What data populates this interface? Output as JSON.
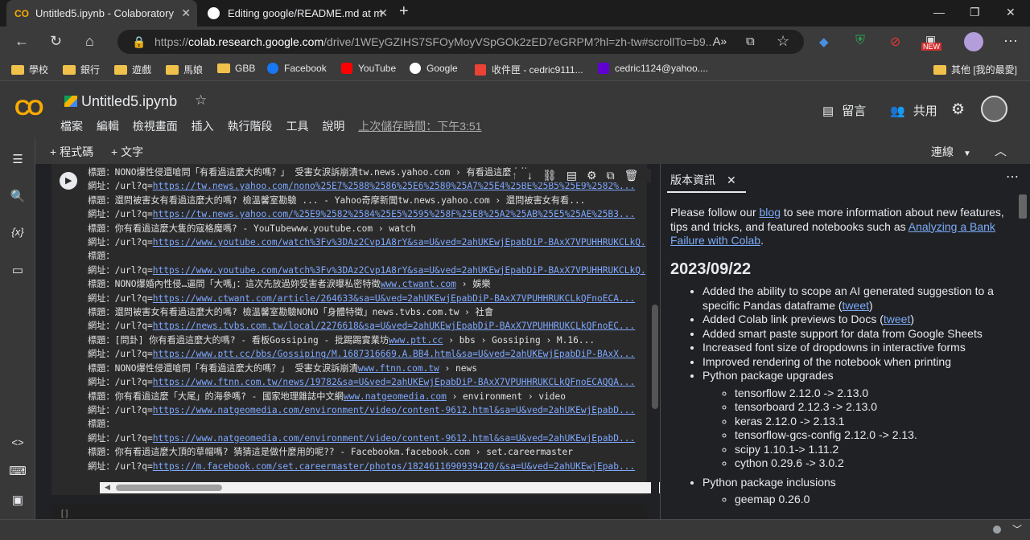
{
  "browser": {
    "tabs": [
      {
        "title": "Untitled5.ipynb - Colaboratory"
      },
      {
        "title": "Editing google/README.md at m"
      }
    ],
    "url_prefix": "https://",
    "url_host": "colab.research.google.com",
    "url_rest": "/drive/1WEyGZIHS7SFOyMoyVSpGOk2zED7eGRPM?hl=zh-tw#scrollTo=b9...",
    "bookmarks": [
      "學校",
      "銀行",
      "遊戲",
      "馬娘",
      "GBB",
      "Facebook",
      "YouTube",
      "Google",
      "收件匣 - cedric9111...",
      "cedric1124@yahoo....",
      "其他 [我的最愛]"
    ],
    "badge_new": "NEW"
  },
  "colab": {
    "logo": "CO",
    "notebook_title": "Untitled5.ipynb",
    "menu": [
      "檔案",
      "編輯",
      "檢視畫面",
      "插入",
      "執行階段",
      "工具",
      "說明"
    ],
    "last_saved": "上次儲存時間：下午3:51",
    "comment_label": "留言",
    "share_label": "共用",
    "add_code": "+ 程式碼",
    "add_text": "+ 文字",
    "connect": "連線",
    "cell_output": [
      {
        "l": "標題：",
        "t": "NONO爆性侵還嗆問「有看過這麼大的嗎？」 受害女淚訴崩潰tw.news.yahoo.com › 有看過這麼大的..."
      },
      {
        "l": "網址：",
        "t": "/url?q=",
        "u": "https://tw.news.yahoo.com/nono%25E7%2588%2586%25E6%2580%25A7%25E4%25BE%25B5%25E9%2582%..."
      },
      {
        "l": "標題：",
        "t": "還問被害女有看過這麼大的嗎? 檢溫馨室勘驗 ... - Yahoo奇摩新聞tw.news.yahoo.com › 還問被害女有看..."
      },
      {
        "l": "網址：",
        "t": "/url?q=",
        "u": "https://tw.news.yahoo.com/%25E9%2582%2584%25E5%2595%258F%25E8%25A2%25AB%25E5%25AE%25B3..."
      },
      {
        "l": "標題：",
        "t": "你有看過這麼大隻的寇格魔嗎? - YouTubewww.youtube.com › watch"
      },
      {
        "l": "網址：",
        "t": "/url?q=",
        "u": "https://www.youtube.com/watch%3Fv%3DAz2Cvp1A8rY&sa=U&ved=2ahUKEwjEpabDiP-BAxX7VPUHHRUKCLkQ..."
      },
      {
        "l": "標題：",
        "t": ""
      },
      {
        "l": "網址：",
        "t": "/url?q=",
        "u": "https://www.youtube.com/watch%3Fv%3DAz2Cvp1A8rY&sa=U&ved=2ahUKEwjEpabDiP-BAxX7VPUHHRUKCLkQ..."
      },
      {
        "l": "標題：",
        "t": "NONO爆婚內性侵…逼問「大嗎」：這次先放過妳受害者淚曝私密特徵",
        "u2": "www.ctwant.com",
        "t2": " › 娛樂"
      },
      {
        "l": "網址：",
        "t": "/url?q=",
        "u": "https://www.ctwant.com/article/264633&sa=U&ved=2ahUKEwjEpabDiP-BAxX7VPUHHRUKCLkQFnoECA..."
      },
      {
        "l": "標題：",
        "t": "還問被害女有看過這麼大的嗎? 檢溫馨室勘驗NONO「身體特徵」news.tvbs.com.tw › 社會"
      },
      {
        "l": "網址：",
        "t": "/url?q=",
        "u": "https://news.tvbs.com.tw/local/2276618&sa=U&ved=2ahUKEwjEpabDiP-BAxX7VPUHHRUKCLkQFnoEC..."
      },
      {
        "l": "標題：",
        "t": "[問卦] 你有看過這麼大的嗎? - 看板Gossiping - 批踢踢實業坊",
        "u2": "www.ptt.cc",
        "t2": " › bbs › Gossiping › M.16..."
      },
      {
        "l": "網址：",
        "t": "/url?q=",
        "u": "https://www.ptt.cc/bbs/Gossiping/M.1687316669.A.BB4.html&sa=U&ved=2ahUKEwjEpabDiP-BAxX..."
      },
      {
        "l": "標題：",
        "t": "NONO爆性侵還嗆問「有看過這麼大的嗎？」 受害女淚訴崩潰",
        "u2": "www.ftnn.com.tw",
        "t2": " › news"
      },
      {
        "l": "網址：",
        "t": "/url?q=",
        "u": "https://www.ftnn.com.tw/news/19782&sa=U&ved=2ahUKEwjEpabDiP-BAxX7VPUHHRUKCLkQFnoECAQQA..."
      },
      {
        "l": "標題：",
        "t": "你有看過這麼「大尾」的海參嗎? - 國家地理雜誌中文網",
        "u2": "www.natgeomedia.com",
        "t2": " › environment › video"
      },
      {
        "l": "網址：",
        "t": "/url?q=",
        "u": "https://www.natgeomedia.com/environment/video/content-9612.html&sa=U&ved=2ahUKEwjEpabD..."
      },
      {
        "l": "標題：",
        "t": ""
      },
      {
        "l": "網址：",
        "t": "/url?q=",
        "u": "https://www.natgeomedia.com/environment/video/content-9612.html&sa=U&ved=2ahUKEwjEpabD..."
      },
      {
        "l": "標題：",
        "t": "你有看過這麼大頂的草帽嗎? 猜猜這是做什麼用的呢?? - Facebookm.facebook.com › set.careermaster"
      },
      {
        "l": "網址：",
        "t": "/url?q=",
        "u": "https://m.facebook.com/set.careermaster/photos/1824611690939420/&sa=U&ved=2ahUKEwjEpab..."
      }
    ],
    "cell2_prompt": "[ ]"
  },
  "panel": {
    "tab": "版本資訊",
    "intro_1": "Please follow our ",
    "intro_link_blog": "blog",
    "intro_2": " to see more information about new features, tips and tricks, and featured notebooks such as ",
    "intro_link_nb": "Analyzing a Bank Failure with Colab",
    "intro_3": ".",
    "date": "2023/09/22",
    "items": [
      {
        "text": "Added the ability to scope an AI generated suggestion to a specific Pandas dataframe (",
        "link": "tweet",
        "after": ")"
      },
      {
        "text": "Added Colab link previews to Docs (",
        "link": "tweet",
        "after": ")"
      },
      {
        "text": "Added smart paste support for data from Google Sheets"
      },
      {
        "text": "Increased font size of dropdowns in interactive forms"
      },
      {
        "text": "Improved rendering of the notebook when printing"
      },
      {
        "text": "Python package upgrades"
      }
    ],
    "upgrades": [
      "tensorflow 2.12.0 -> 2.13.0",
      "tensorboard 2.12.3 -> 2.13.0",
      "keras 2.12.0 -> 2.13.1",
      "tensorflow-gcs-config 2.12.0 -> 2.13.",
      "scipy 1.10.1-> 1.11.2",
      "cython 0.29.6 -> 3.0.2"
    ],
    "inclusions_label": "Python package inclusions",
    "inclusions": [
      "geemap 0.26.0"
    ]
  }
}
